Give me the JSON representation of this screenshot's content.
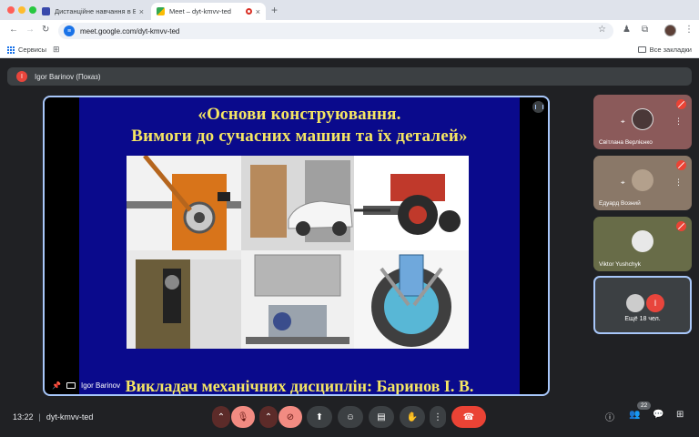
{
  "browser": {
    "tabs": [
      {
        "title": "Дистанційне навчання в ВСП",
        "active": false
      },
      {
        "title": "Meet – dyt-kmvv-ted",
        "active": true
      }
    ],
    "url": "meet.google.com/dyt-kmvv-ted",
    "bookmarks": {
      "apps_label": "Сервисы",
      "all_label": "Все закладки"
    }
  },
  "meeting": {
    "presenter_label": "Igor Barinov (Показ)",
    "presenter_initial": "I",
    "stage_label": "Igor Barinov",
    "time": "13:22",
    "code": "dyt-kmvv-ted",
    "people_count": "22"
  },
  "slide": {
    "title_line1": "«Основи конструювання.",
    "title_line2": "Вимоги до сучасних машин та їх деталей»",
    "footer": "Викладач механічних дисциплін: Баринов І. В."
  },
  "participants": [
    {
      "name": "Світлана Верлієнко",
      "muted": true,
      "color": "#8b5a5a"
    },
    {
      "name": "Едуард Возний",
      "muted": true,
      "color": "#8a7868"
    },
    {
      "name": "Viktor Yushchyk",
      "muted": true,
      "color": "#686c48"
    }
  ],
  "more_tile": {
    "label": "Ещё 18 чел.",
    "initial": "I"
  },
  "colors": {
    "accent": "#a8c7fa",
    "danger": "#ea4335",
    "slide_bg": "#0a0a8c",
    "slide_text": "#f5e663"
  }
}
